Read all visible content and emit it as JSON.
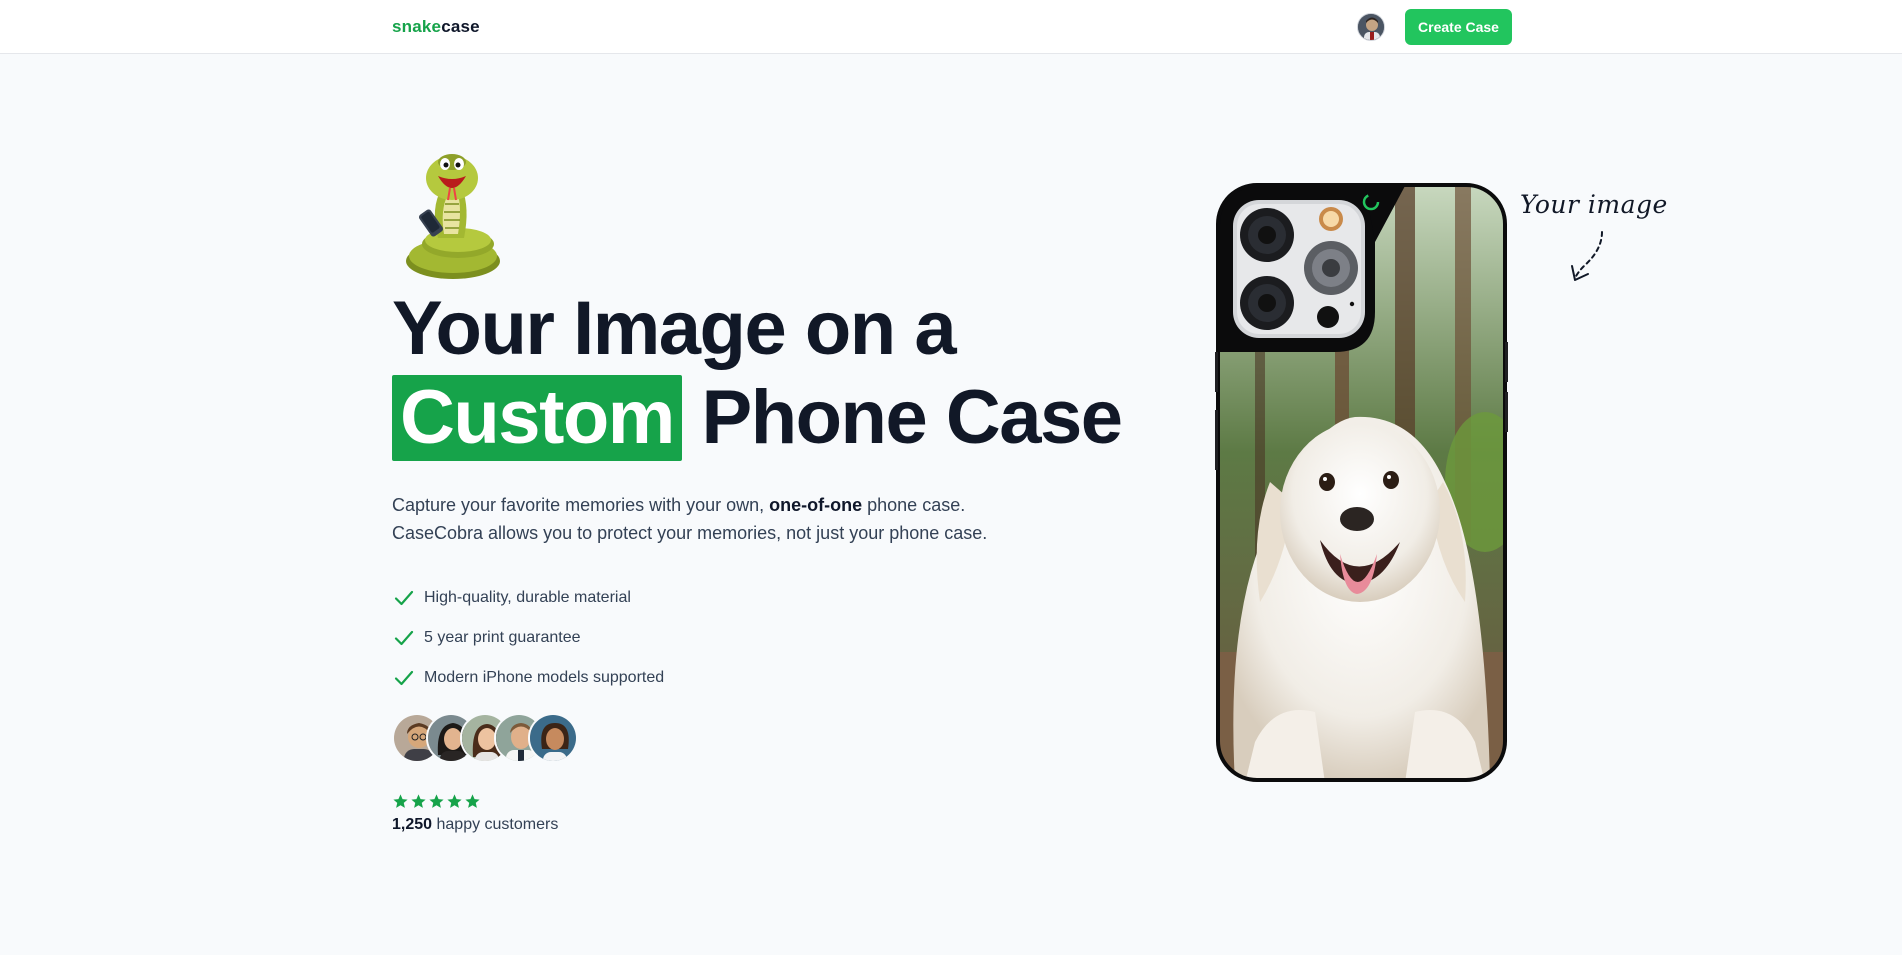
{
  "navbar": {
    "logo_part1": "snake",
    "logo_part2": "case",
    "create_button": "Create Case"
  },
  "hero": {
    "headline_line1": "Your Image on a",
    "headline_highlight": "Custom",
    "headline_rest": "Phone Case",
    "description_part1": "Capture your favorite memories with your own, ",
    "description_bold": "one-of-one",
    "description_part2": " phone case.",
    "description_line2": "CaseCobra allows you to protect your memories, not just your phone case.",
    "features": [
      "High-quality, durable material",
      "5 year print guarantee",
      "Modern iPhone models supported"
    ],
    "rating_stars": 5,
    "customers_count": "1,250",
    "customers_label": " happy customers"
  },
  "phone_annotation": "Your image",
  "colors": {
    "brand_green": "#16a34a",
    "button_green": "#22c55e",
    "background": "#f8fafc",
    "text_dark": "#0f172a"
  }
}
